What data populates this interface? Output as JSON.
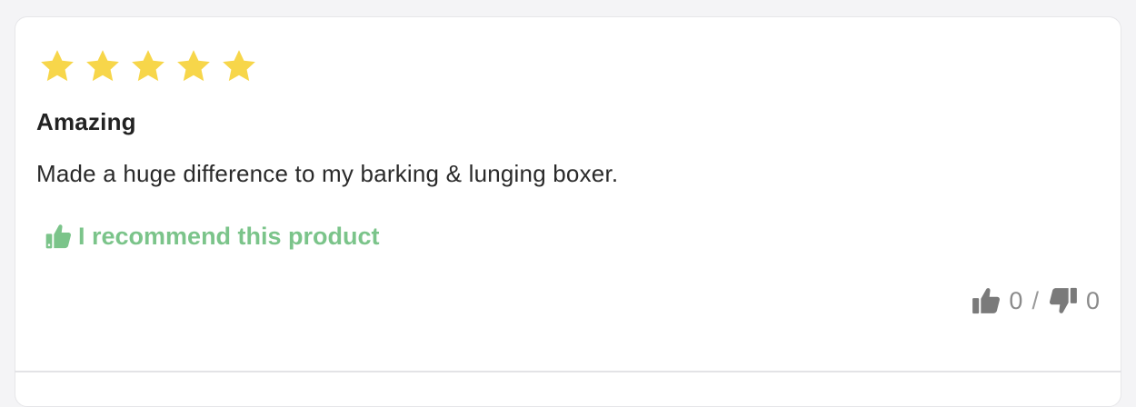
{
  "review": {
    "rating": 5,
    "max_rating": 5,
    "star_color": "#f7d64a",
    "title": "Amazing",
    "body": "Made a huge difference to my barking & lunging boxer.",
    "recommend_label": "I recommend this product",
    "recommend_color": "#7bc48a"
  },
  "votes": {
    "helpful_icon": "thumbs-up-icon",
    "helpful_count": "0",
    "separator": "/",
    "unhelpful_icon": "thumbs-down-icon",
    "unhelpful_count": "0",
    "icon_color": "#7a7a7a"
  }
}
